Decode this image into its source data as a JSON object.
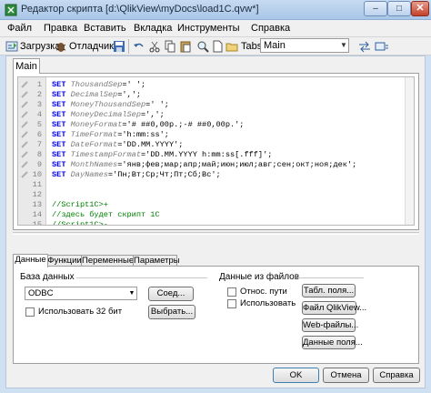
{
  "window": {
    "title": "Редактор скрипта [d:\\QlikView\\myDocs\\load1C.qvw*]",
    "minimize": "–",
    "maximize": "□",
    "close": "✕"
  },
  "menu": [
    "Файл",
    "Правка",
    "Вставить",
    "Вкладка",
    "Инструменты",
    "Справка"
  ],
  "toolbar": {
    "load_label": "Загрузка",
    "debug_label": "Отладчик",
    "tabs_label": "Tabs",
    "tab_selected": "Main"
  },
  "editor": {
    "tab_label": "Main",
    "lines": [
      {
        "n": "1",
        "kw": "SET",
        "name": "ThousandSep",
        "val": "=' ';"
      },
      {
        "n": "2",
        "kw": "SET",
        "name": "DecimalSep",
        "val": "=',';"
      },
      {
        "n": "3",
        "kw": "SET",
        "name": "MoneyThousandSep",
        "val": "=' ';"
      },
      {
        "n": "4",
        "kw": "SET",
        "name": "MoneyDecimalSep",
        "val": "=',';"
      },
      {
        "n": "5",
        "kw": "SET",
        "name": "MoneyFormat",
        "val": "='# ##0,00р.;-# ##0,00р.';"
      },
      {
        "n": "6",
        "kw": "SET",
        "name": "TimeFormat",
        "val": "='h:mm:ss';"
      },
      {
        "n": "7",
        "kw": "SET",
        "name": "DateFormat",
        "val": "='DD.MM.YYYY';"
      },
      {
        "n": "8",
        "kw": "SET",
        "name": "TimestampFormat",
        "val": "='DD.MM.YYYY h:mm:ss[.fff]';"
      },
      {
        "n": "9",
        "kw": "SET",
        "name": "MonthNames",
        "val": "='янв;фев;мар;апр;май;июн;июл;авг;сен;окт;ноя;дек';"
      },
      {
        "n": "10",
        "kw": "SET",
        "name": "DayNames",
        "val": "='Пн;Вт;Ср;Чт;Пт;Сб;Вс';"
      },
      {
        "n": "11",
        "kw": "",
        "name": "",
        "val": ""
      },
      {
        "n": "12",
        "kw": "",
        "name": "",
        "val": ""
      },
      {
        "n": "13",
        "kw": "",
        "name": "",
        "val": "",
        "comment": "//Script1C>+"
      },
      {
        "n": "14",
        "kw": "",
        "name": "",
        "val": "",
        "comment": "//здесь будет скрипт 1С"
      },
      {
        "n": "15",
        "kw": "",
        "name": "",
        "val": "",
        "comment": "//Script1C>-"
      },
      {
        "n": "16",
        "kw": "",
        "name": "",
        "val": ""
      }
    ]
  },
  "bottom_tabs": [
    "Данные",
    "Функции",
    "Переменные",
    "Параметры"
  ],
  "data_panel": {
    "db_group_label": "База данных",
    "db_value": "ODBC",
    "connect_button": "Соед...",
    "select_button": "Выбрать...",
    "use32_label": "Использовать 32 бит",
    "files_group_label": "Данные из файлов",
    "relative_paths_label": "Относ. пути",
    "use_ftp_label": "Использовать",
    "table_files_button": "Табл. поля...",
    "qlikview_file_button": "Файл QlikView...",
    "web_files_button": "Web-файлы...",
    "field_data_button": "Данные поля..."
  },
  "dialog": {
    "ok": "OK",
    "cancel": "Отмена",
    "help": "Справка"
  }
}
